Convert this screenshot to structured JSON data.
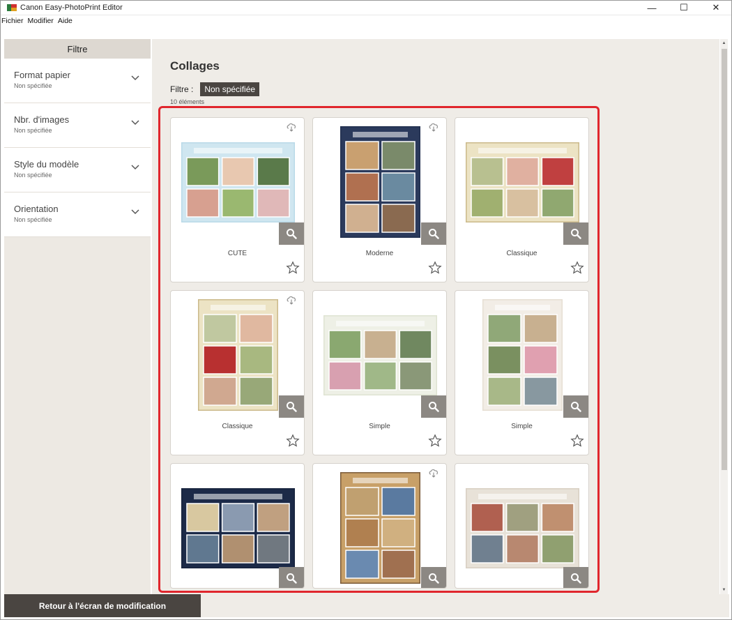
{
  "window": {
    "title": "Canon Easy-PhotoPrint Editor",
    "controls": {
      "minimize": "—",
      "maximize": "☐",
      "close": "✕"
    }
  },
  "menu": [
    {
      "label": "Fichier"
    },
    {
      "label": "Modifier"
    },
    {
      "label": "Aide"
    }
  ],
  "sidebar": {
    "header": "Filtre",
    "filters": [
      {
        "label": "Format papier",
        "value": "Non spécifiée",
        "icon": "chevron-down-icon"
      },
      {
        "label": "Nbr. d'images",
        "value": "Non spécifiée",
        "icon": "chevron-down-icon"
      },
      {
        "label": "Style du modèle",
        "value": "Non spécifiée",
        "icon": "chevron-down-icon"
      },
      {
        "label": "Orientation",
        "value": "Non spécifiée",
        "icon": "chevron-down-icon"
      }
    ]
  },
  "main": {
    "title": "Collages",
    "filter_label": "Filtre :",
    "filter_value": "Non spécifiée",
    "count": "10 éléments"
  },
  "templates": [
    {
      "name": "CUTE",
      "cloud": true,
      "orientation": "landscape"
    },
    {
      "name": "Moderne",
      "cloud": true,
      "orientation": "portrait"
    },
    {
      "name": "Classique",
      "cloud": false,
      "orientation": "landscape"
    },
    {
      "name": "Classique",
      "cloud": true,
      "orientation": "portrait"
    },
    {
      "name": "Simple",
      "cloud": false,
      "orientation": "landscape"
    },
    {
      "name": "Simple",
      "cloud": false,
      "orientation": "portrait"
    },
    {
      "name": "",
      "cloud": false,
      "orientation": "landscape"
    },
    {
      "name": "",
      "cloud": true,
      "orientation": "portrait"
    },
    {
      "name": "",
      "cloud": false,
      "orientation": "landscape"
    }
  ],
  "footer": {
    "back_label": "Retour à l'écran de modification"
  },
  "colors": {
    "accent_highlight": "#e0262d",
    "dark_button": "#4a4541",
    "panel_bg": "#efece7",
    "zoom_bg": "#8c8883"
  }
}
